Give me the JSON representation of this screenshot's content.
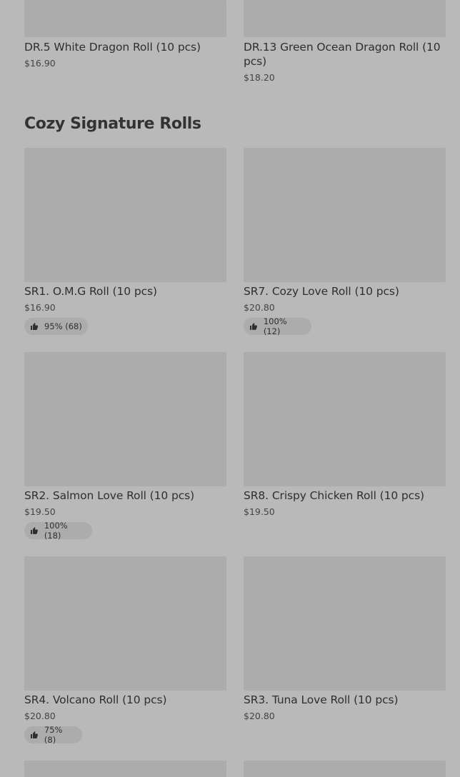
{
  "top_items": [
    {
      "name": "DR.5 White Dragon Roll (10 pcs)",
      "price": "$16.90"
    },
    {
      "name": "DR.13 Green Ocean Dragon Roll (10 pcs)",
      "price": "$18.20"
    }
  ],
  "section": {
    "title": "Cozy Signature Rolls",
    "items": [
      {
        "name": "SR1. O.M.G Roll (10 pcs)",
        "price": "$16.90",
        "rating": "95% (68)"
      },
      {
        "name": "SR7. Cozy Love Roll (10 pcs)",
        "price": "$20.80",
        "rating": "100% (12)"
      },
      {
        "name": "SR2. Salmon Love Roll (10 pcs)",
        "price": "$19.50",
        "rating": "100% (18)"
      },
      {
        "name": "SR8. Crispy Chicken Roll (10 pcs)",
        "price": "$19.50"
      },
      {
        "name": "SR4. Volcano Roll (10 pcs)",
        "price": "$20.80",
        "rating": "75% (8)"
      },
      {
        "name": "SR3. Tuna Love Roll (10 pcs)",
        "price": "$20.80"
      }
    ]
  },
  "icons": {
    "rating": "thumbs-up-icon"
  },
  "colors": {
    "background": "#b9b9b9",
    "image_placeholder": "#acacac",
    "text": "#2f2f2f"
  }
}
